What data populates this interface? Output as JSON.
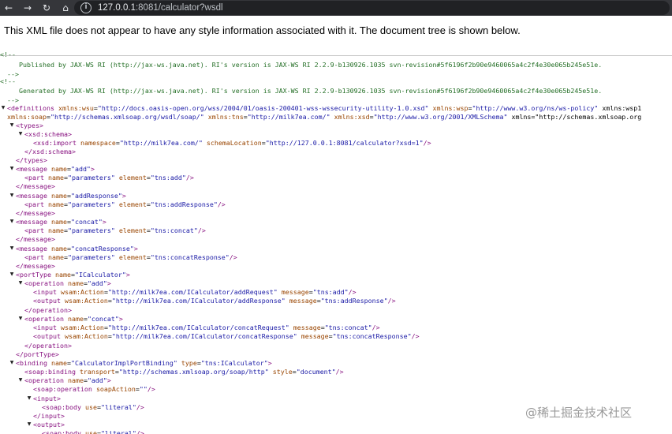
{
  "toolbar": {
    "back_icon": "←",
    "forward_icon": "→",
    "reload_icon": "↻",
    "home_icon": "⌂",
    "info_icon": "i",
    "url_host": "127.0.0.1",
    "url_rest": ":8081/calculator?wsdl"
  },
  "notice": "This XML file does not appear to have any style information associated with it. The document tree is shown below.",
  "arrow_open": "▼",
  "arrow_closed": "▶",
  "comment1": {
    "open": "<!--",
    "body": "Published by JAX-WS RI (http://jax-ws.java.net). RI's version is JAX-WS RI 2.2.9-b130926.1035 svn-revision#5f6196f2b90e9460065a4c2f4e30e065b245e51e.",
    "close": "-->"
  },
  "comment2": {
    "open": "<!--",
    "body": "Generated by JAX-WS RI (http://jax-ws.java.net). RI's version is JAX-WS RI 2.2.9-b130926.1035 svn-revision#5f6196f2b90e9460065a4c2f4e30e065b245e51e.",
    "close": "-->"
  },
  "definitions": {
    "line1": "<definitions xmlns:wsu=\"http://docs.oasis-open.org/wss/2004/01/oasis-200401-wss-wssecurity-utility-1.0.xsd\" xmlns:wsp=\"http://www.w3.org/ns/ws-policy\" xmlns:wsp1",
    "line2": "xmlns:soap=\"http://schemas.xmlsoap.org/wsdl/soap/\" xmlns:tns=\"http://milk7ea.com/\" xmlns:xsd=\"http://www.w3.org/2001/XMLSchema\" xmlns=\"http://schemas.xmlsoap.org"
  },
  "types": {
    "open": "<types>",
    "schema_open": "<xsd:schema>",
    "import": "<xsd:import namespace=\"http://milk7ea.com/\" schemaLocation=\"http://127.0.0.1:8081/calculator?xsd=1\"/>",
    "schema_close": "</xsd:schema>",
    "close": "</types>"
  },
  "messages": [
    {
      "open": "<message name=\"add\">",
      "part": "<part name=\"parameters\" element=\"tns:add\"/>",
      "close": "</message>"
    },
    {
      "open": "<message name=\"addResponse\">",
      "part": "<part name=\"parameters\" element=\"tns:addResponse\"/>",
      "close": "</message>"
    },
    {
      "open": "<message name=\"concat\">",
      "part": "<part name=\"parameters\" element=\"tns:concat\"/>",
      "close": "</message>"
    },
    {
      "open": "<message name=\"concatResponse\">",
      "part": "<part name=\"parameters\" element=\"tns:concatResponse\"/>",
      "close": "</message>"
    }
  ],
  "porttype": {
    "open": "<portType name=\"ICalculator\">",
    "operations": [
      {
        "open": "<operation name=\"add\">",
        "input": "<input wsam:Action=\"http://milk7ea.com/ICalculator/addRequest\" message=\"tns:add\"/>",
        "output": "<output wsam:Action=\"http://milk7ea.com/ICalculator/addResponse\" message=\"tns:addResponse\"/>",
        "close": "</operation>"
      },
      {
        "open": "<operation name=\"concat\">",
        "input": "<input wsam:Action=\"http://milk7ea.com/ICalculator/concatRequest\" message=\"tns:concat\"/>",
        "output": "<output wsam:Action=\"http://milk7ea.com/ICalculator/concatResponse\" message=\"tns:concatResponse\"/>",
        "close": "</operation>"
      }
    ],
    "close": "</portType>"
  },
  "binding": {
    "open": "<binding name=\"CalculatorImplPortBinding\" type=\"tns:ICalculator\">",
    "soap_binding": "<soap:binding transport=\"http://schemas.xmlsoap.org/soap/http\" style=\"document\"/>",
    "op_open": "<operation name=\"add\">",
    "soap_op": "<soap:operation soapAction=\"\"/>",
    "input_open": "<input>",
    "body1": "<soap:body use=\"literal\"/>",
    "input_close": "</input>",
    "output_open": "<output>",
    "body2": "<soap:body use=\"literal\"/>"
  },
  "watermark": "@稀土掘金技术社区"
}
